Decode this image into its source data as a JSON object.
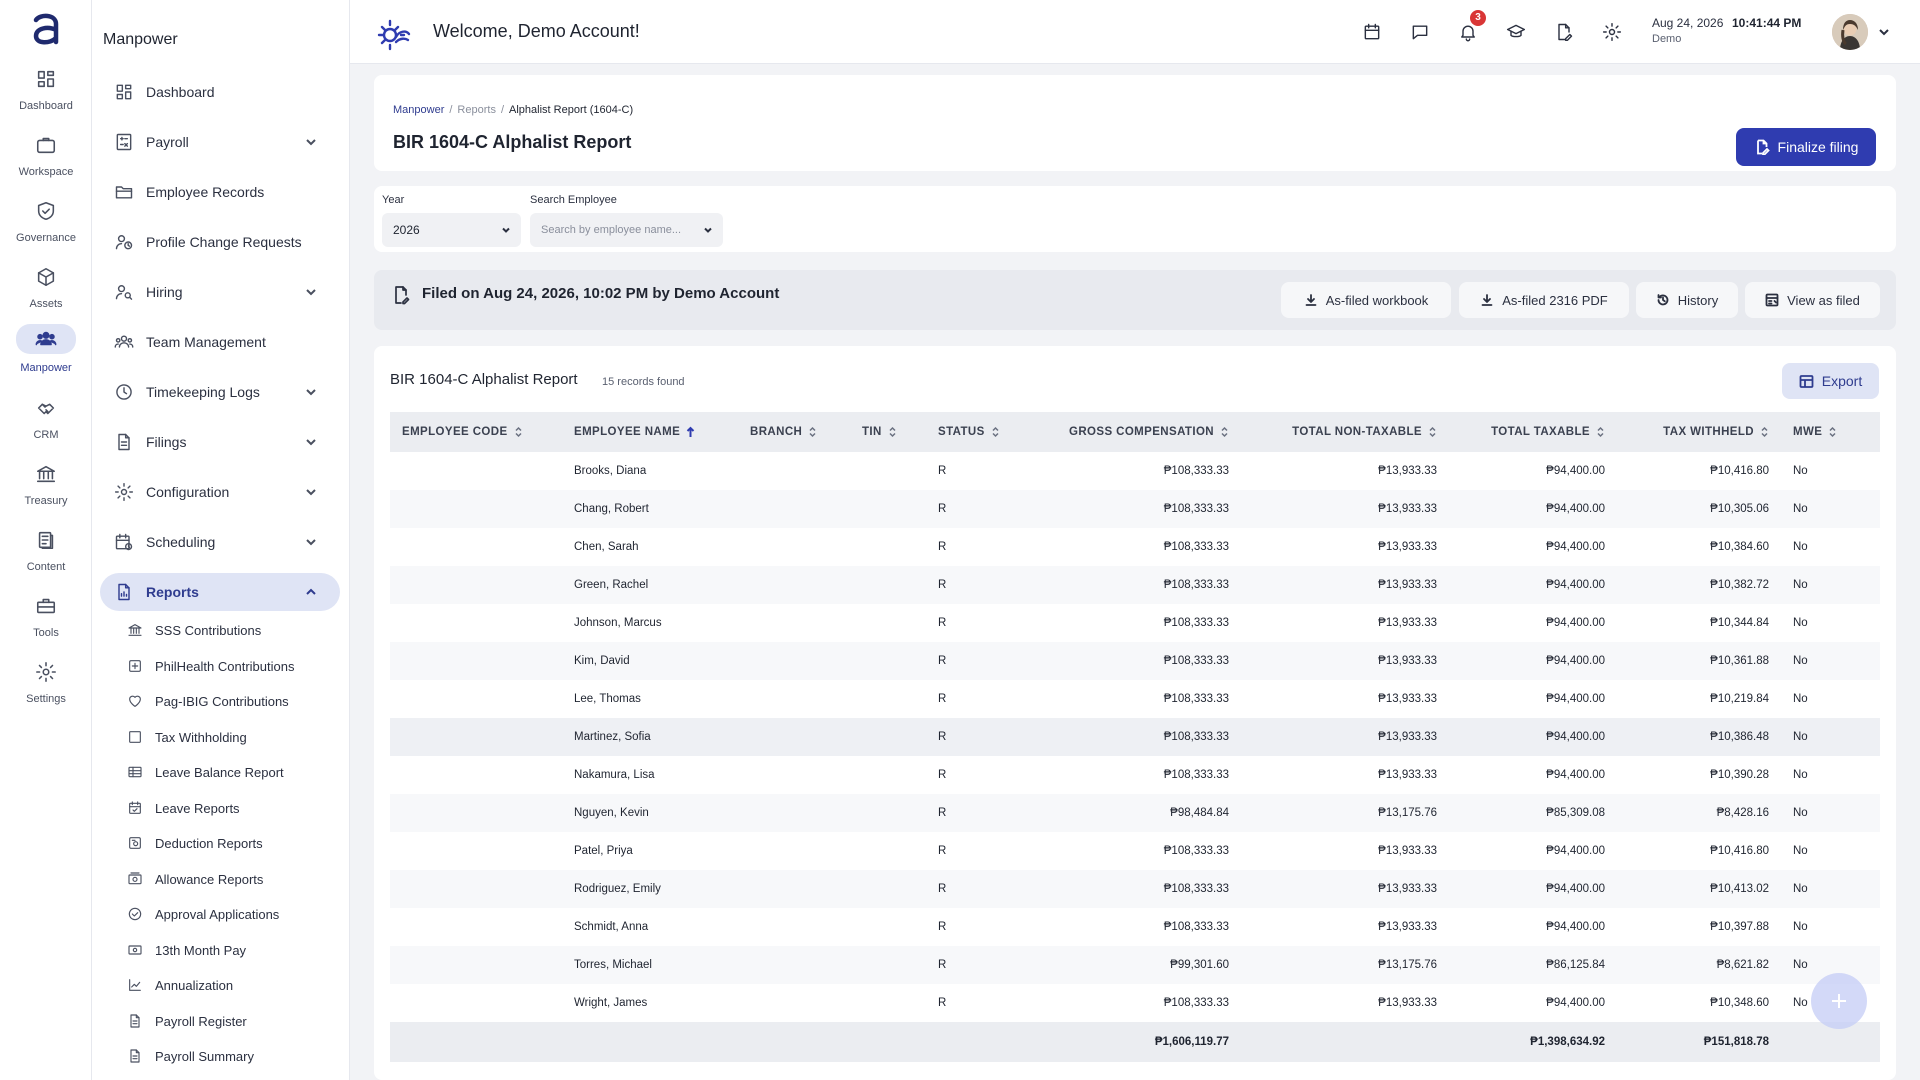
{
  "rail": {
    "items": [
      {
        "label": "Dashboard",
        "icon": "dashboard-icon"
      },
      {
        "label": "Workspace",
        "icon": "briefcase-icon"
      },
      {
        "label": "Governance",
        "icon": "shield-check-icon"
      },
      {
        "label": "Assets",
        "icon": "box-icon"
      },
      {
        "label": "Manpower",
        "icon": "people-icon"
      },
      {
        "label": "CRM",
        "icon": "handshake-icon"
      },
      {
        "label": "Treasury",
        "icon": "bank-icon"
      },
      {
        "label": "Content",
        "icon": "document-icon"
      },
      {
        "label": "Tools",
        "icon": "toolbox-icon"
      },
      {
        "label": "Settings",
        "icon": "gear-icon"
      }
    ],
    "active": "Manpower"
  },
  "sidebar": {
    "title": "Manpower",
    "items": [
      {
        "label": "Dashboard",
        "icon": "dashboard-icon",
        "expandable": false
      },
      {
        "label": "Payroll",
        "icon": "calculator-icon",
        "expandable": true
      },
      {
        "label": "Employee Records",
        "icon": "folder-icon",
        "expandable": false
      },
      {
        "label": "Profile Change Requests",
        "icon": "user-clock-icon",
        "expandable": false
      },
      {
        "label": "Hiring",
        "icon": "user-search-icon",
        "expandable": true
      },
      {
        "label": "Team Management",
        "icon": "team-icon",
        "expandable": false
      },
      {
        "label": "Timekeeping Logs",
        "icon": "clock-icon",
        "expandable": true
      },
      {
        "label": "Filings",
        "icon": "file-icon",
        "expandable": true
      },
      {
        "label": "Configuration",
        "icon": "gear-icon",
        "expandable": true
      },
      {
        "label": "Scheduling",
        "icon": "calendar-clock-icon",
        "expandable": true
      },
      {
        "label": "Reports",
        "icon": "report-icon",
        "expandable": true
      }
    ],
    "active": "Reports",
    "sub_items": [
      {
        "label": "SSS Contributions",
        "icon": "institution-icon"
      },
      {
        "label": "PhilHealth Contributions",
        "icon": "plus-box-icon"
      },
      {
        "label": "Pag-IBIG Contributions",
        "icon": "heart-icon"
      },
      {
        "label": "Tax Withholding",
        "icon": "square-icon"
      },
      {
        "label": "Leave Balance Report",
        "icon": "table-icon"
      },
      {
        "label": "Leave Reports",
        "icon": "calendar-check-icon"
      },
      {
        "label": "Deduction Reports",
        "icon": "receipt-icon"
      },
      {
        "label": "Allowance Reports",
        "icon": "cash-icon"
      },
      {
        "label": "Approval Applications",
        "icon": "check-circle-icon"
      },
      {
        "label": "13th Month Pay",
        "icon": "money-icon"
      },
      {
        "label": "Annualization",
        "icon": "line-chart-icon"
      },
      {
        "label": "Payroll Register",
        "icon": "file-text-icon"
      },
      {
        "label": "Payroll Summary",
        "icon": "file-text-icon"
      }
    ]
  },
  "header": {
    "welcome": "Welcome, Demo Account!",
    "notification_count": "3",
    "date": "Aug 24, 2026",
    "time": "10:41:44 PM",
    "user": "Demo"
  },
  "page": {
    "breadcrumb": [
      "Manpower",
      "Reports",
      "Alphalist Report (1604-C)"
    ],
    "title": "BIR 1604-C Alphalist Report",
    "finalize_label": "Finalize filing"
  },
  "filters": {
    "year_label": "Year",
    "year_value": "2026",
    "search_label": "Search Employee",
    "search_placeholder": "Search by employee name..."
  },
  "filed": {
    "text": "Filed on Aug 24, 2026, 10:02 PM by Demo Account",
    "buttons": [
      "As-filed workbook",
      "As-filed 2316 PDF",
      "History",
      "View as filed"
    ]
  },
  "table": {
    "title": "BIR 1604-C Alphalist Report",
    "count": "15 records found",
    "export_label": "Export",
    "columns": [
      "Employee Code",
      "Employee Name",
      "Branch",
      "TIN",
      "Status",
      "Gross Compensation",
      "Total Non-Taxable",
      "Total Taxable",
      "Tax Withheld",
      "MWE"
    ],
    "sorted_column": "Employee Name",
    "rows": [
      {
        "code": "",
        "name": "Brooks, Diana",
        "branch": "",
        "tin": "",
        "status": "R",
        "gross": "₱108,333.33",
        "nontax": "₱13,933.33",
        "taxable": "₱94,400.00",
        "withheld": "₱10,416.80",
        "mwe": "No"
      },
      {
        "code": "",
        "name": "Chang, Robert",
        "branch": "",
        "tin": "",
        "status": "R",
        "gross": "₱108,333.33",
        "nontax": "₱13,933.33",
        "taxable": "₱94,400.00",
        "withheld": "₱10,305.06",
        "mwe": "No"
      },
      {
        "code": "",
        "name": "Chen, Sarah",
        "branch": "",
        "tin": "",
        "status": "R",
        "gross": "₱108,333.33",
        "nontax": "₱13,933.33",
        "taxable": "₱94,400.00",
        "withheld": "₱10,384.60",
        "mwe": "No"
      },
      {
        "code": "",
        "name": "Green, Rachel",
        "branch": "",
        "tin": "",
        "status": "R",
        "gross": "₱108,333.33",
        "nontax": "₱13,933.33",
        "taxable": "₱94,400.00",
        "withheld": "₱10,382.72",
        "mwe": "No"
      },
      {
        "code": "",
        "name": "Johnson, Marcus",
        "branch": "",
        "tin": "",
        "status": "R",
        "gross": "₱108,333.33",
        "nontax": "₱13,933.33",
        "taxable": "₱94,400.00",
        "withheld": "₱10,344.84",
        "mwe": "No"
      },
      {
        "code": "",
        "name": "Kim, David",
        "branch": "",
        "tin": "",
        "status": "R",
        "gross": "₱108,333.33",
        "nontax": "₱13,933.33",
        "taxable": "₱94,400.00",
        "withheld": "₱10,361.88",
        "mwe": "No"
      },
      {
        "code": "",
        "name": "Lee, Thomas",
        "branch": "",
        "tin": "",
        "status": "R",
        "gross": "₱108,333.33",
        "nontax": "₱13,933.33",
        "taxable": "₱94,400.00",
        "withheld": "₱10,219.84",
        "mwe": "No"
      },
      {
        "code": "",
        "name": "Martinez, Sofia",
        "branch": "",
        "tin": "",
        "status": "R",
        "gross": "₱108,333.33",
        "nontax": "₱13,933.33",
        "taxable": "₱94,400.00",
        "withheld": "₱10,386.48",
        "mwe": "No"
      },
      {
        "code": "",
        "name": "Nakamura, Lisa",
        "branch": "",
        "tin": "",
        "status": "R",
        "gross": "₱108,333.33",
        "nontax": "₱13,933.33",
        "taxable": "₱94,400.00",
        "withheld": "₱10,390.28",
        "mwe": "No"
      },
      {
        "code": "",
        "name": "Nguyen, Kevin",
        "branch": "",
        "tin": "",
        "status": "R",
        "gross": "₱98,484.84",
        "nontax": "₱13,175.76",
        "taxable": "₱85,309.08",
        "withheld": "₱8,428.16",
        "mwe": "No"
      },
      {
        "code": "",
        "name": "Patel, Priya",
        "branch": "",
        "tin": "",
        "status": "R",
        "gross": "₱108,333.33",
        "nontax": "₱13,933.33",
        "taxable": "₱94,400.00",
        "withheld": "₱10,416.80",
        "mwe": "No"
      },
      {
        "code": "",
        "name": "Rodriguez, Emily",
        "branch": "",
        "tin": "",
        "status": "R",
        "gross": "₱108,333.33",
        "nontax": "₱13,933.33",
        "taxable": "₱94,400.00",
        "withheld": "₱10,413.02",
        "mwe": "No"
      },
      {
        "code": "",
        "name": "Schmidt, Anna",
        "branch": "",
        "tin": "",
        "status": "R",
        "gross": "₱108,333.33",
        "nontax": "₱13,933.33",
        "taxable": "₱94,400.00",
        "withheld": "₱10,397.88",
        "mwe": "No"
      },
      {
        "code": "",
        "name": "Torres, Michael",
        "branch": "",
        "tin": "",
        "status": "R",
        "gross": "₱99,301.60",
        "nontax": "₱13,175.76",
        "taxable": "₱86,125.84",
        "withheld": "₱8,621.82",
        "mwe": "No"
      },
      {
        "code": "",
        "name": "Wright, James",
        "branch": "",
        "tin": "",
        "status": "R",
        "gross": "₱108,333.33",
        "nontax": "₱13,933.33",
        "taxable": "₱94,400.00",
        "withheld": "₱10,348.60",
        "mwe": "No"
      }
    ],
    "totals": {
      "gross": "₱1,606,119.77",
      "nontax": "",
      "taxable": "₱1,398,634.92",
      "withheld": "₱151,818.78"
    }
  },
  "colors": {
    "primary": "#2f3cb0",
    "accent_light": "#dfe4f5",
    "badge": "#d93636"
  }
}
